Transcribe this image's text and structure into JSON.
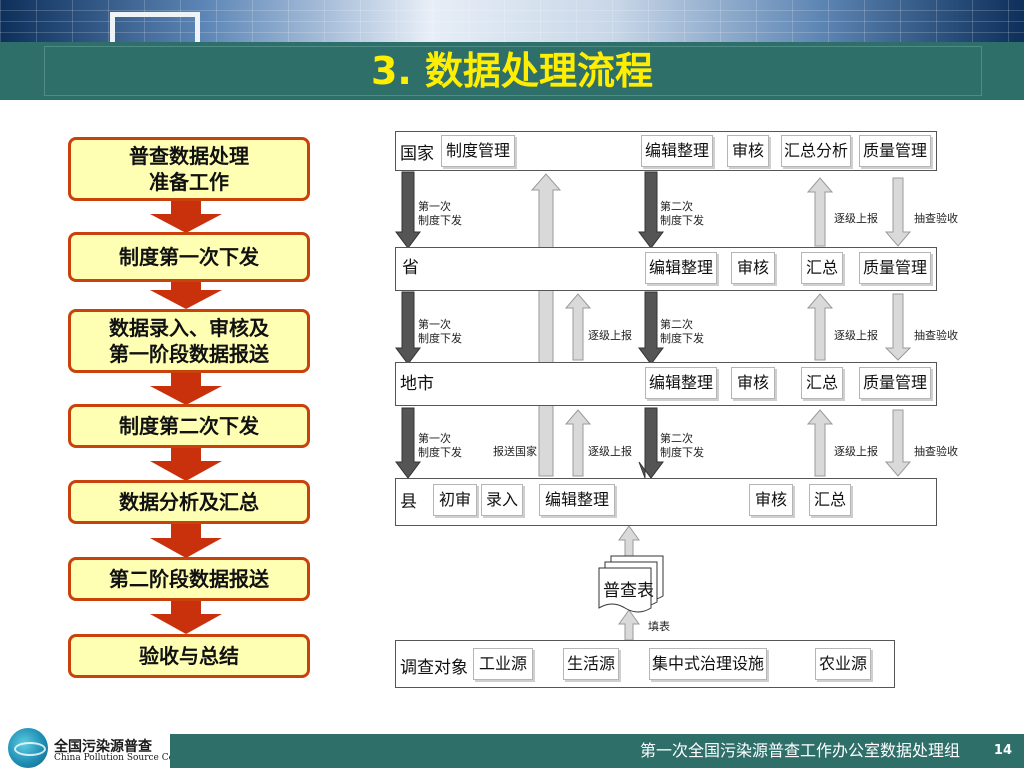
{
  "header": {
    "title": "3. 数据处理流程"
  },
  "flow_steps": [
    {
      "label": "普查数据处理\n准备工作"
    },
    {
      "label": "制度第一次下发"
    },
    {
      "label": "数据录入、审核及\n第一阶段数据报送"
    },
    {
      "label": "制度第二次下发"
    },
    {
      "label": "数据分析及汇总"
    },
    {
      "label": "第二阶段数据报送"
    },
    {
      "label": "验收与总结"
    }
  ],
  "levels": {
    "national": {
      "name": "国家",
      "boxes": [
        "制度管理",
        "编辑整理",
        "审核",
        "汇总分析",
        "质量管理"
      ]
    },
    "province": {
      "name": "省",
      "boxes": [
        "编辑整理",
        "审核",
        "汇总",
        "质量管理"
      ]
    },
    "city": {
      "name": "地市",
      "boxes": [
        "编辑整理",
        "审核",
        "汇总",
        "质量管理"
      ]
    },
    "county": {
      "name": "县",
      "boxes": [
        "初审",
        "录入",
        "编辑整理",
        "审核",
        "汇总"
      ]
    },
    "survey": {
      "name": "调查对象",
      "boxes": [
        "工业源",
        "生活源",
        "集中式治理设施",
        "农业源"
      ]
    }
  },
  "arrow_labels": {
    "first_issue": "第一次\n制度下发",
    "second_issue": "第二次\n制度下发",
    "report_up": "逐级上报",
    "spot_check": "抽查验收",
    "report_national": "报送国家",
    "fill_form": "填表"
  },
  "census_form": {
    "label": "普查表"
  },
  "footer": {
    "org_text": "第一次全国污染源普查工作办公室数据处理组",
    "page_number": "14"
  },
  "logo": {
    "name_cn": "全国污染源普查",
    "name_en": "China Pollution Source Census"
  },
  "colors": {
    "title_bar": "#2f6f6a",
    "title_text": "#ffee00",
    "step_fill": "#ffffb4",
    "step_border": "#c8420b",
    "red_arrow": "#c9300c",
    "dark_arrow": "#555555",
    "light_arrow": "#d6d6d6"
  }
}
